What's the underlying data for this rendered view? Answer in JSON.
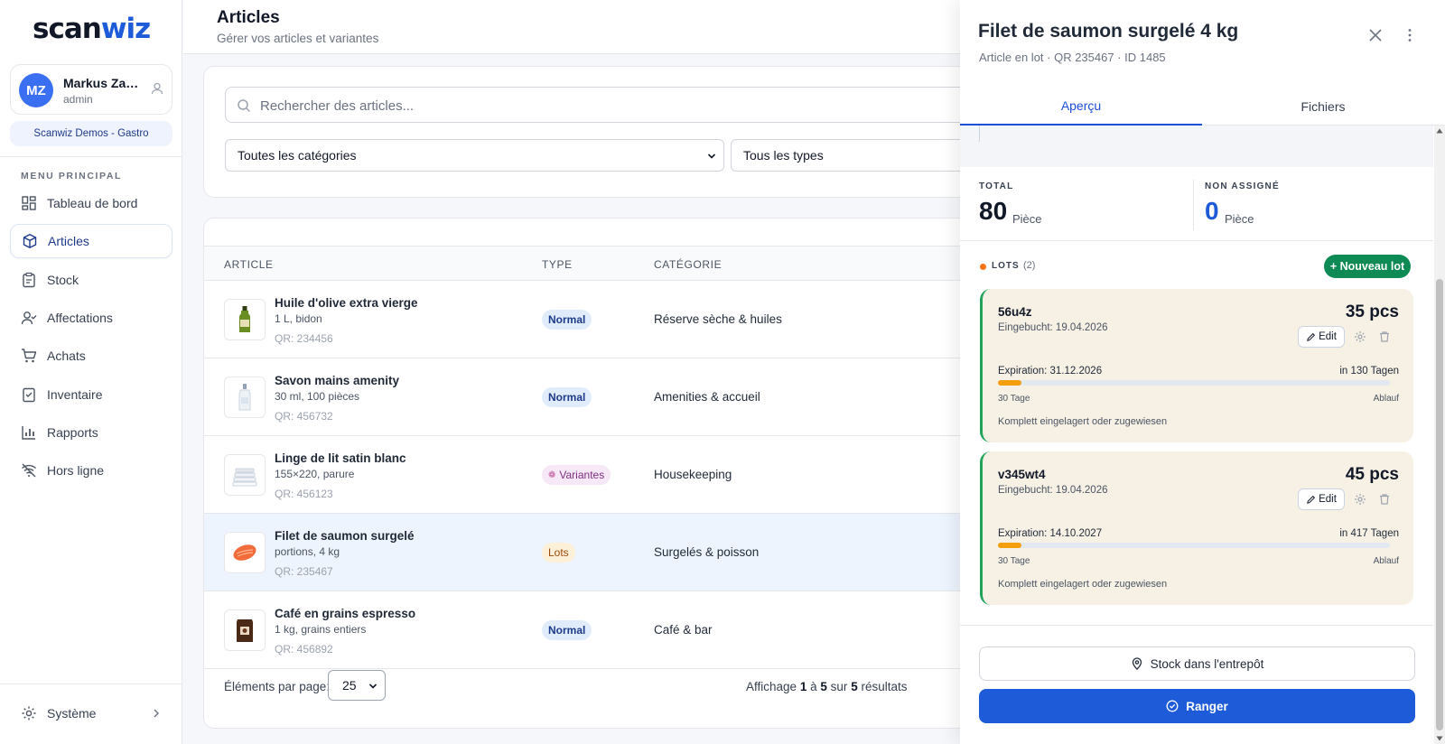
{
  "brand": {
    "logo_a": "scan",
    "logo_b": "wiz"
  },
  "user": {
    "initials": "MZ",
    "name": "Markus Zau...",
    "role": "admin",
    "org": "Scanwiz Demos - Gastro"
  },
  "sidebar": {
    "heading": "MENU PRINCIPAL",
    "items": [
      {
        "label": "Tableau de bord",
        "icon": "dashboard-icon"
      },
      {
        "label": "Articles",
        "icon": "box-icon"
      },
      {
        "label": "Stock",
        "icon": "clipboard-icon"
      },
      {
        "label": "Affectations",
        "icon": "user-assign-icon"
      },
      {
        "label": "Achats",
        "icon": "cart-icon"
      },
      {
        "label": "Inventaire",
        "icon": "checklist-icon"
      },
      {
        "label": "Rapports",
        "icon": "bar-chart-icon"
      },
      {
        "label": "Hors ligne",
        "icon": "wifi-off-icon"
      }
    ],
    "system": "Système"
  },
  "header": {
    "title": "Articles",
    "subtitle": "Gérer vos articles et variantes"
  },
  "filters": {
    "search_placeholder": "Rechercher des articles...",
    "category_select": "Toutes les catégories",
    "type_select": "Tous les types"
  },
  "table": {
    "columns": {
      "article": "ARTICLE",
      "type": "TYPE",
      "category": "CATÉGORIE"
    },
    "rows": [
      {
        "name": "Huile d'olive extra vierge",
        "desc": "1 L, bidon",
        "qr": "QR: 234456",
        "type": "Normal",
        "category": "Réserve sèche & huiles"
      },
      {
        "name": "Savon mains amenity",
        "desc": "30 ml, 100 pièces",
        "qr": "QR: 456732",
        "type": "Normal",
        "category": "Amenities & accueil"
      },
      {
        "name": "Linge de lit satin blanc",
        "desc": "155×220, parure",
        "qr": "QR: 456123",
        "type": "Variantes",
        "category": "Housekeeping"
      },
      {
        "name": "Filet de saumon surgelé",
        "desc": "portions, 4 kg",
        "qr": "QR: 235467",
        "type": "Lots",
        "category": "Surgelés & poisson"
      },
      {
        "name": "Café en grains espresso",
        "desc": "1 kg, grains entiers",
        "qr": "QR: 456892",
        "type": "Normal",
        "category": "Café & bar"
      }
    ],
    "footer": {
      "per_page_label": "Éléments par page:",
      "per_page_value": "25",
      "results_prefix": "Affichage",
      "from": "1",
      "to_word": "à",
      "to": "5",
      "of_word": "sur",
      "total": "5",
      "results_suffix": "résultats"
    }
  },
  "drawer": {
    "title": "Filet de saumon surgelé 4 kg",
    "meta": "Article en lot · QR  235467 · ID 1485",
    "tabs": [
      "Aperçu",
      "Fichiers"
    ],
    "stats": {
      "total_label": "TOTAL",
      "total_value": "80",
      "total_unit": "Pièce",
      "unassigned_label": "NON ASSIGNÉ",
      "unassigned_value": "0",
      "unassigned_unit": "Pièce"
    },
    "lots_label": "LOTS",
    "lots_count": "(2)",
    "new_lot": "+ Nouveau lot",
    "lots": [
      {
        "code": "56u4z",
        "booked": "Eingebucht: 19.04.2026",
        "qty": "35 pcs",
        "edit": "Edit",
        "expiration": "Expiration: 31.12.2026",
        "days": "in 130 Tagen",
        "progress": 0.06,
        "start_label": "30 Tage",
        "end_label": "Ablauf",
        "status": "Komplett eingelagert oder zugewiesen"
      },
      {
        "code": "v345wt4",
        "booked": "Eingebucht: 19.04.2026",
        "qty": "45 pcs",
        "edit": "Edit",
        "expiration": "Expiration: 14.10.2027",
        "days": "in 417 Tagen",
        "progress": 0.06,
        "start_label": "30 Tage",
        "end_label": "Ablauf",
        "status": "Komplett eingelagert oder zugewiesen"
      }
    ],
    "btn_stock": "Stock dans l'entrepôt",
    "btn_ranger": "Ranger"
  },
  "colors": {
    "primary": "#1d5bd8",
    "success": "#0e8a55",
    "lot_bg": "#f7f0e4",
    "accent_orange": "#f59e0b"
  }
}
